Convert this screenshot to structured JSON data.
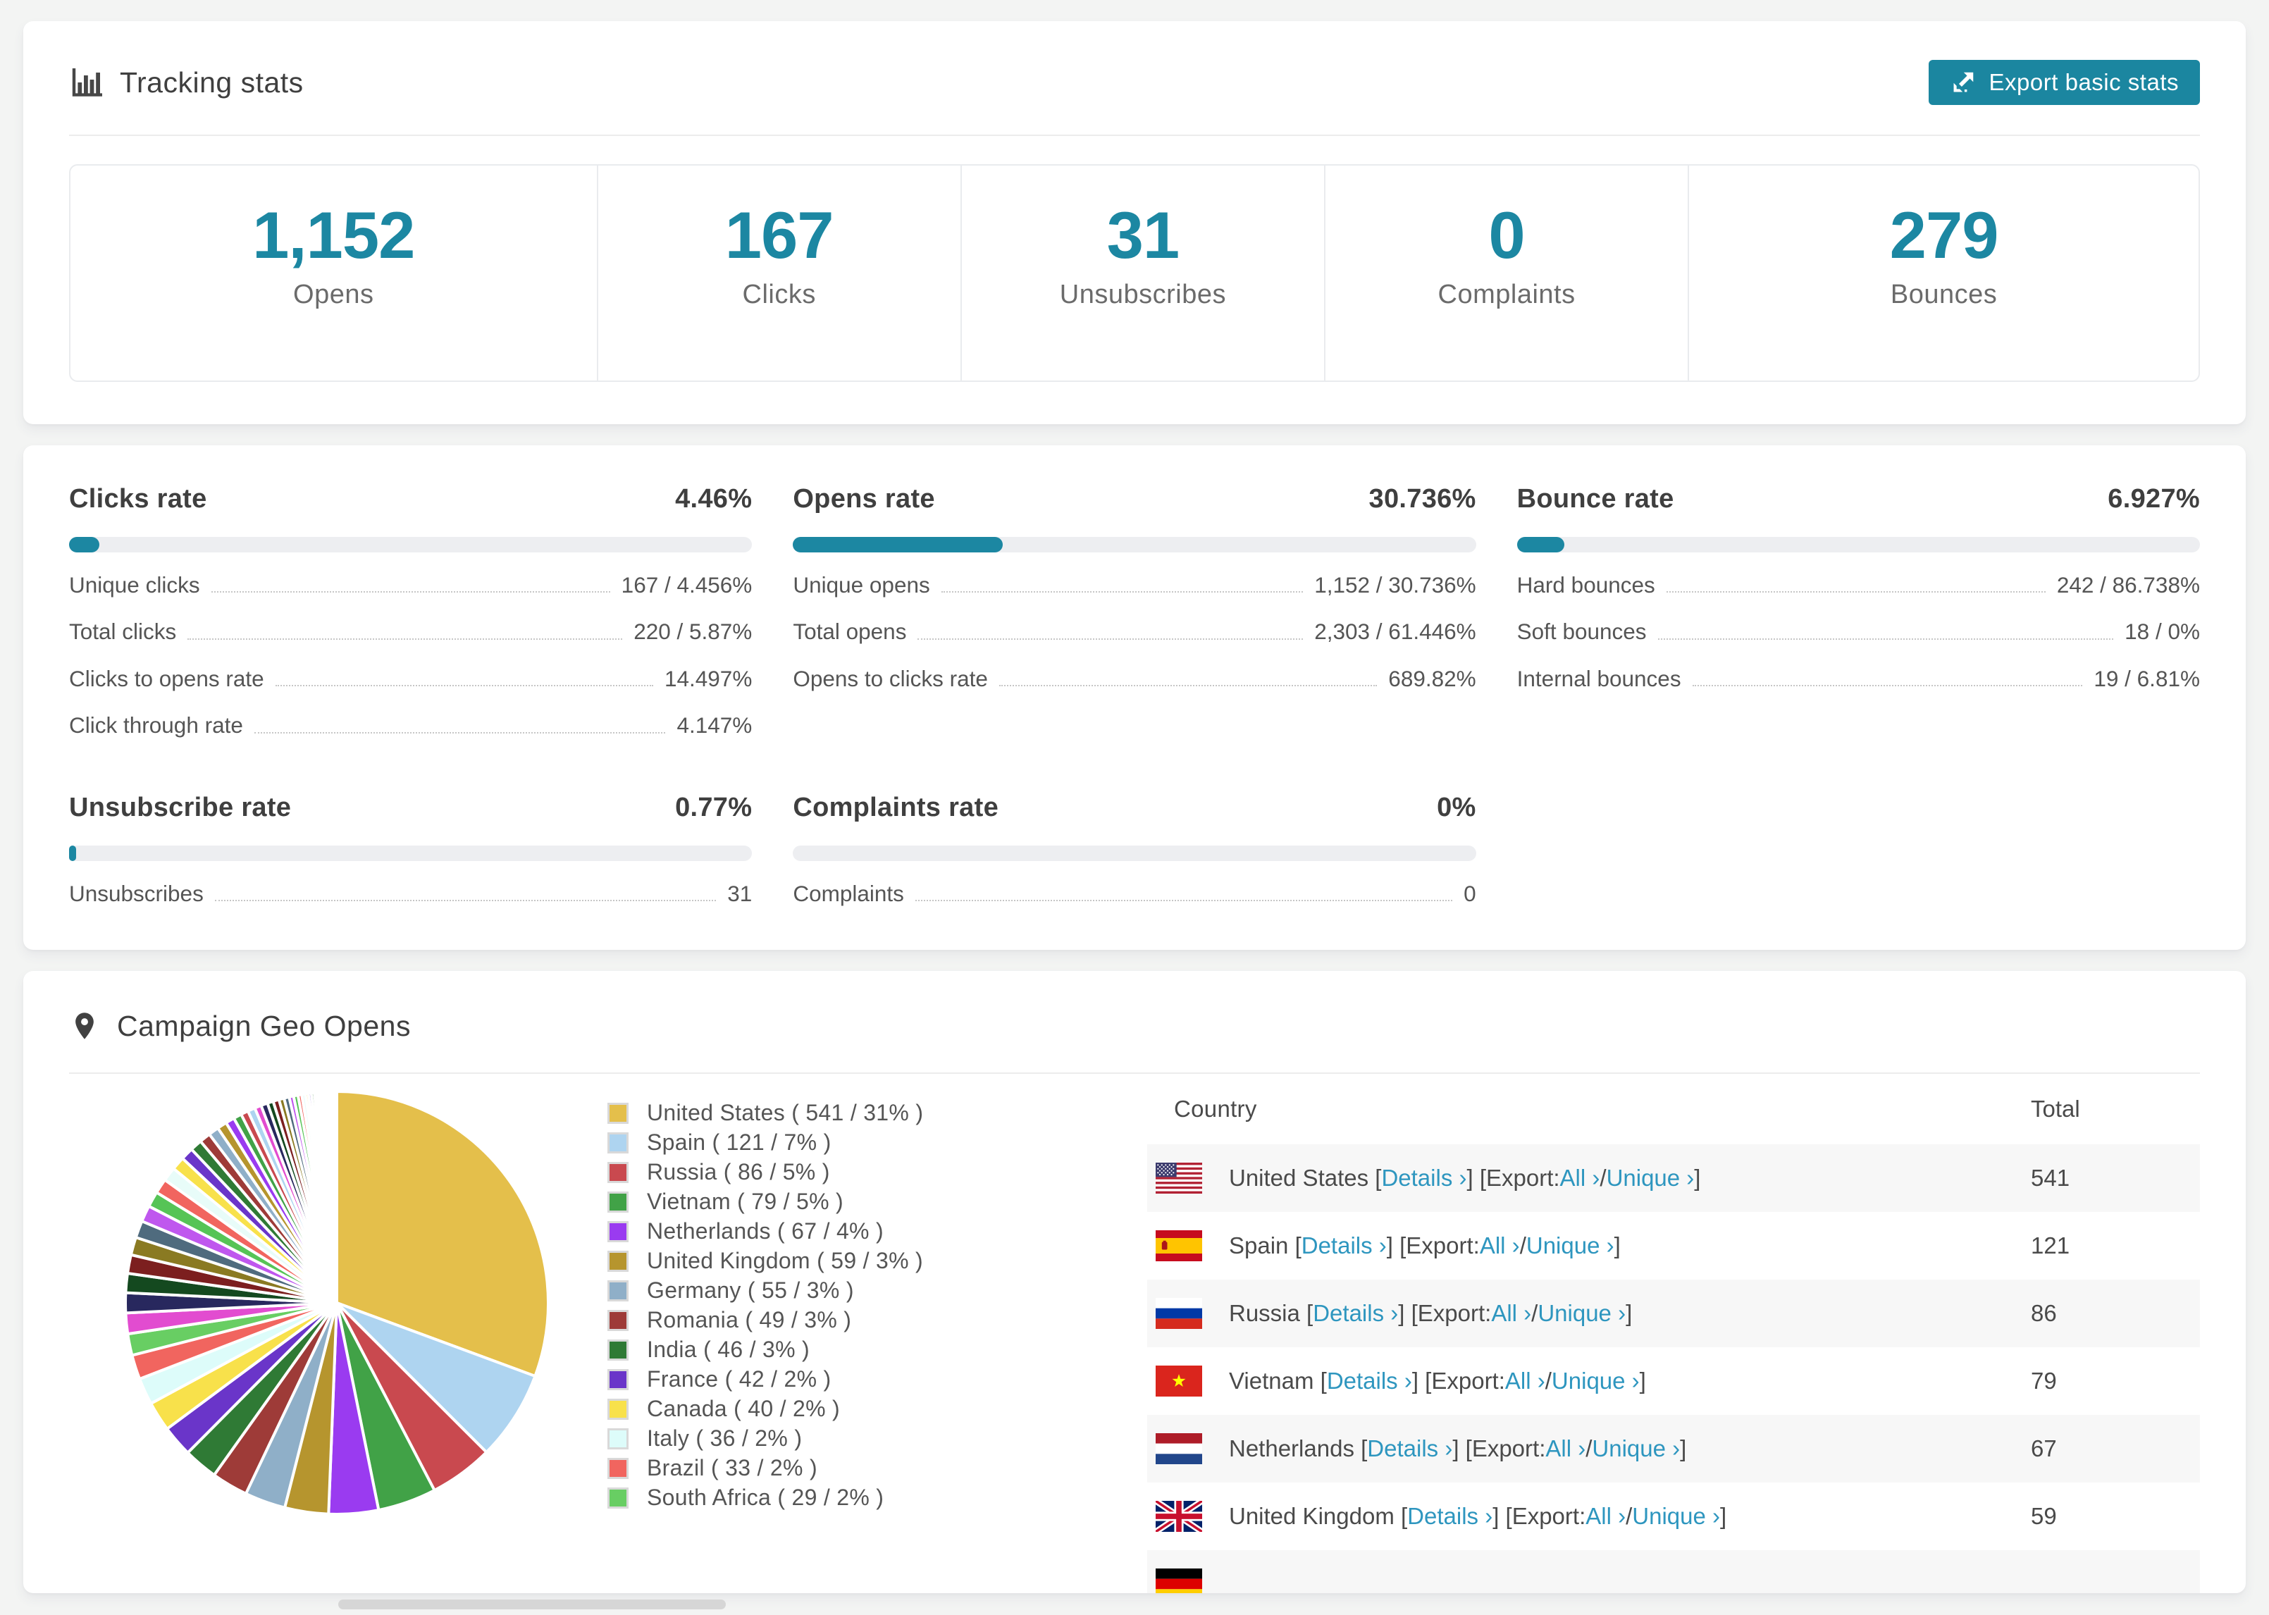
{
  "colors": {
    "accent": "#1c87a2",
    "button_bg": "#1b86a0",
    "link": "#2e96bf",
    "progress_track": "#edeef1",
    "zebra_row": "#f7f7f7",
    "page_bg": "#f3f4f3"
  },
  "tracking": {
    "title": "Tracking stats",
    "export_label": "Export basic stats",
    "stats": [
      {
        "value": "1,152",
        "label": "Opens"
      },
      {
        "value": "167",
        "label": "Clicks"
      },
      {
        "value": "31",
        "label": "Unsubscribes"
      },
      {
        "value": "0",
        "label": "Complaints"
      },
      {
        "value": "279",
        "label": "Bounces"
      }
    ]
  },
  "rates": [
    {
      "title": "Clicks rate",
      "value": "4.46%",
      "percent": 4.46,
      "rows": [
        {
          "label": "Unique clicks",
          "value": "167 / 4.456%"
        },
        {
          "label": "Total clicks",
          "value": "220 / 5.87%"
        },
        {
          "label": "Clicks to opens rate",
          "value": "14.497%"
        },
        {
          "label": "Click through rate",
          "value": "4.147%"
        }
      ]
    },
    {
      "title": "Opens rate",
      "value": "30.736%",
      "percent": 30.736,
      "rows": [
        {
          "label": "Unique opens",
          "value": "1,152 / 30.736%"
        },
        {
          "label": "Total opens",
          "value": "2,303 / 61.446%"
        },
        {
          "label": "Opens to clicks rate",
          "value": "689.82%"
        }
      ]
    },
    {
      "title": "Bounce rate",
      "value": "6.927%",
      "percent": 6.927,
      "rows": [
        {
          "label": "Hard bounces",
          "value": "242 / 86.738%"
        },
        {
          "label": "Soft bounces",
          "value": "18 / 0%"
        },
        {
          "label": "Internal bounces",
          "value": "19 / 6.81%"
        }
      ]
    },
    {
      "title": "Unsubscribe rate",
      "value": "0.77%",
      "percent": 0.77,
      "rows": [
        {
          "label": "Unsubscribes",
          "value": "31"
        }
      ]
    },
    {
      "title": "Complaints rate",
      "value": "0%",
      "percent": 0,
      "rows": [
        {
          "label": "Complaints",
          "value": "0"
        }
      ]
    }
  ],
  "geo": {
    "title": "Campaign Geo Opens",
    "table": {
      "columns": [
        "Country",
        "Total"
      ],
      "labels": {
        "details": "Details",
        "export": "Export:",
        "all": "All",
        "unique": "Unique",
        "chevron": "›"
      },
      "rows": [
        {
          "flag": "us",
          "country": "United States",
          "total": "541"
        },
        {
          "flag": "es",
          "country": "Spain",
          "total": "121"
        },
        {
          "flag": "ru",
          "country": "Russia",
          "total": "86"
        },
        {
          "flag": "vn",
          "country": "Vietnam",
          "total": "79"
        },
        {
          "flag": "nl",
          "country": "Netherlands",
          "total": "67"
        },
        {
          "flag": "gb",
          "country": "United Kingdom",
          "total": "59"
        },
        {
          "flag": "de",
          "country": "",
          "total": "",
          "partial": true
        }
      ]
    }
  },
  "chart_data": {
    "type": "pie",
    "title": "Campaign Geo Opens",
    "legend_position": "right",
    "start_angle_deg": 0,
    "direction": "clockwise",
    "legend_format": "label ( value / pct% )",
    "series": [
      {
        "label": "United States",
        "value": 541,
        "pct": 31,
        "color": "#e4bf4b"
      },
      {
        "label": "Spain",
        "value": 121,
        "pct": 7,
        "color": "#aed4f0"
      },
      {
        "label": "Russia",
        "value": 86,
        "pct": 5,
        "color": "#c9494f"
      },
      {
        "label": "Vietnam",
        "value": 79,
        "pct": 5,
        "color": "#41a247"
      },
      {
        "label": "Netherlands",
        "value": 67,
        "pct": 4,
        "color": "#9a3bf0"
      },
      {
        "label": "United Kingdom",
        "value": 59,
        "pct": 3,
        "color": "#b6952e"
      },
      {
        "label": "Germany",
        "value": 55,
        "pct": 3,
        "color": "#8fafc8"
      },
      {
        "label": "Romania",
        "value": 49,
        "pct": 3,
        "color": "#9e3b38"
      },
      {
        "label": "India",
        "value": 46,
        "pct": 3,
        "color": "#2f7a35"
      },
      {
        "label": "France",
        "value": 42,
        "pct": 2,
        "color": "#6a35c9"
      },
      {
        "label": "Canada",
        "value": 40,
        "pct": 2,
        "color": "#f8e14b"
      },
      {
        "label": "Italy",
        "value": 36,
        "pct": 2,
        "color": "#ddfcfa"
      },
      {
        "label": "Brazil",
        "value": 33,
        "pct": 2,
        "color": "#f1655f"
      },
      {
        "label": "South Africa",
        "value": 29,
        "pct": 2,
        "color": "#68ce63"
      }
    ],
    "unlabeled_small_slices": {
      "estimated_values": [
        28,
        27,
        26,
        25,
        24,
        23,
        22,
        21,
        20,
        19,
        18,
        17,
        16,
        15,
        14,
        13,
        12,
        11,
        10,
        10,
        9,
        9,
        8,
        8,
        7,
        7,
        6,
        6,
        5,
        5,
        4,
        4,
        4,
        3,
        3,
        3,
        3,
        2,
        2,
        2,
        2,
        2,
        1,
        1,
        1,
        1,
        1,
        1,
        1,
        1
      ],
      "palette": [
        "#e24cd0",
        "#28285e",
        "#14491f",
        "#7c1f1f",
        "#8a7a22",
        "#4f6b7e",
        "#bf57ee",
        "#56c456",
        "#f1655f",
        "#e8fcf9",
        "#f8e14b",
        "#6a35c9",
        "#2f7a35",
        "#9e3b38",
        "#8fafc8",
        "#b6952e",
        "#9a3bf0",
        "#41a247",
        "#c9494f",
        "#aed4f0"
      ]
    }
  }
}
